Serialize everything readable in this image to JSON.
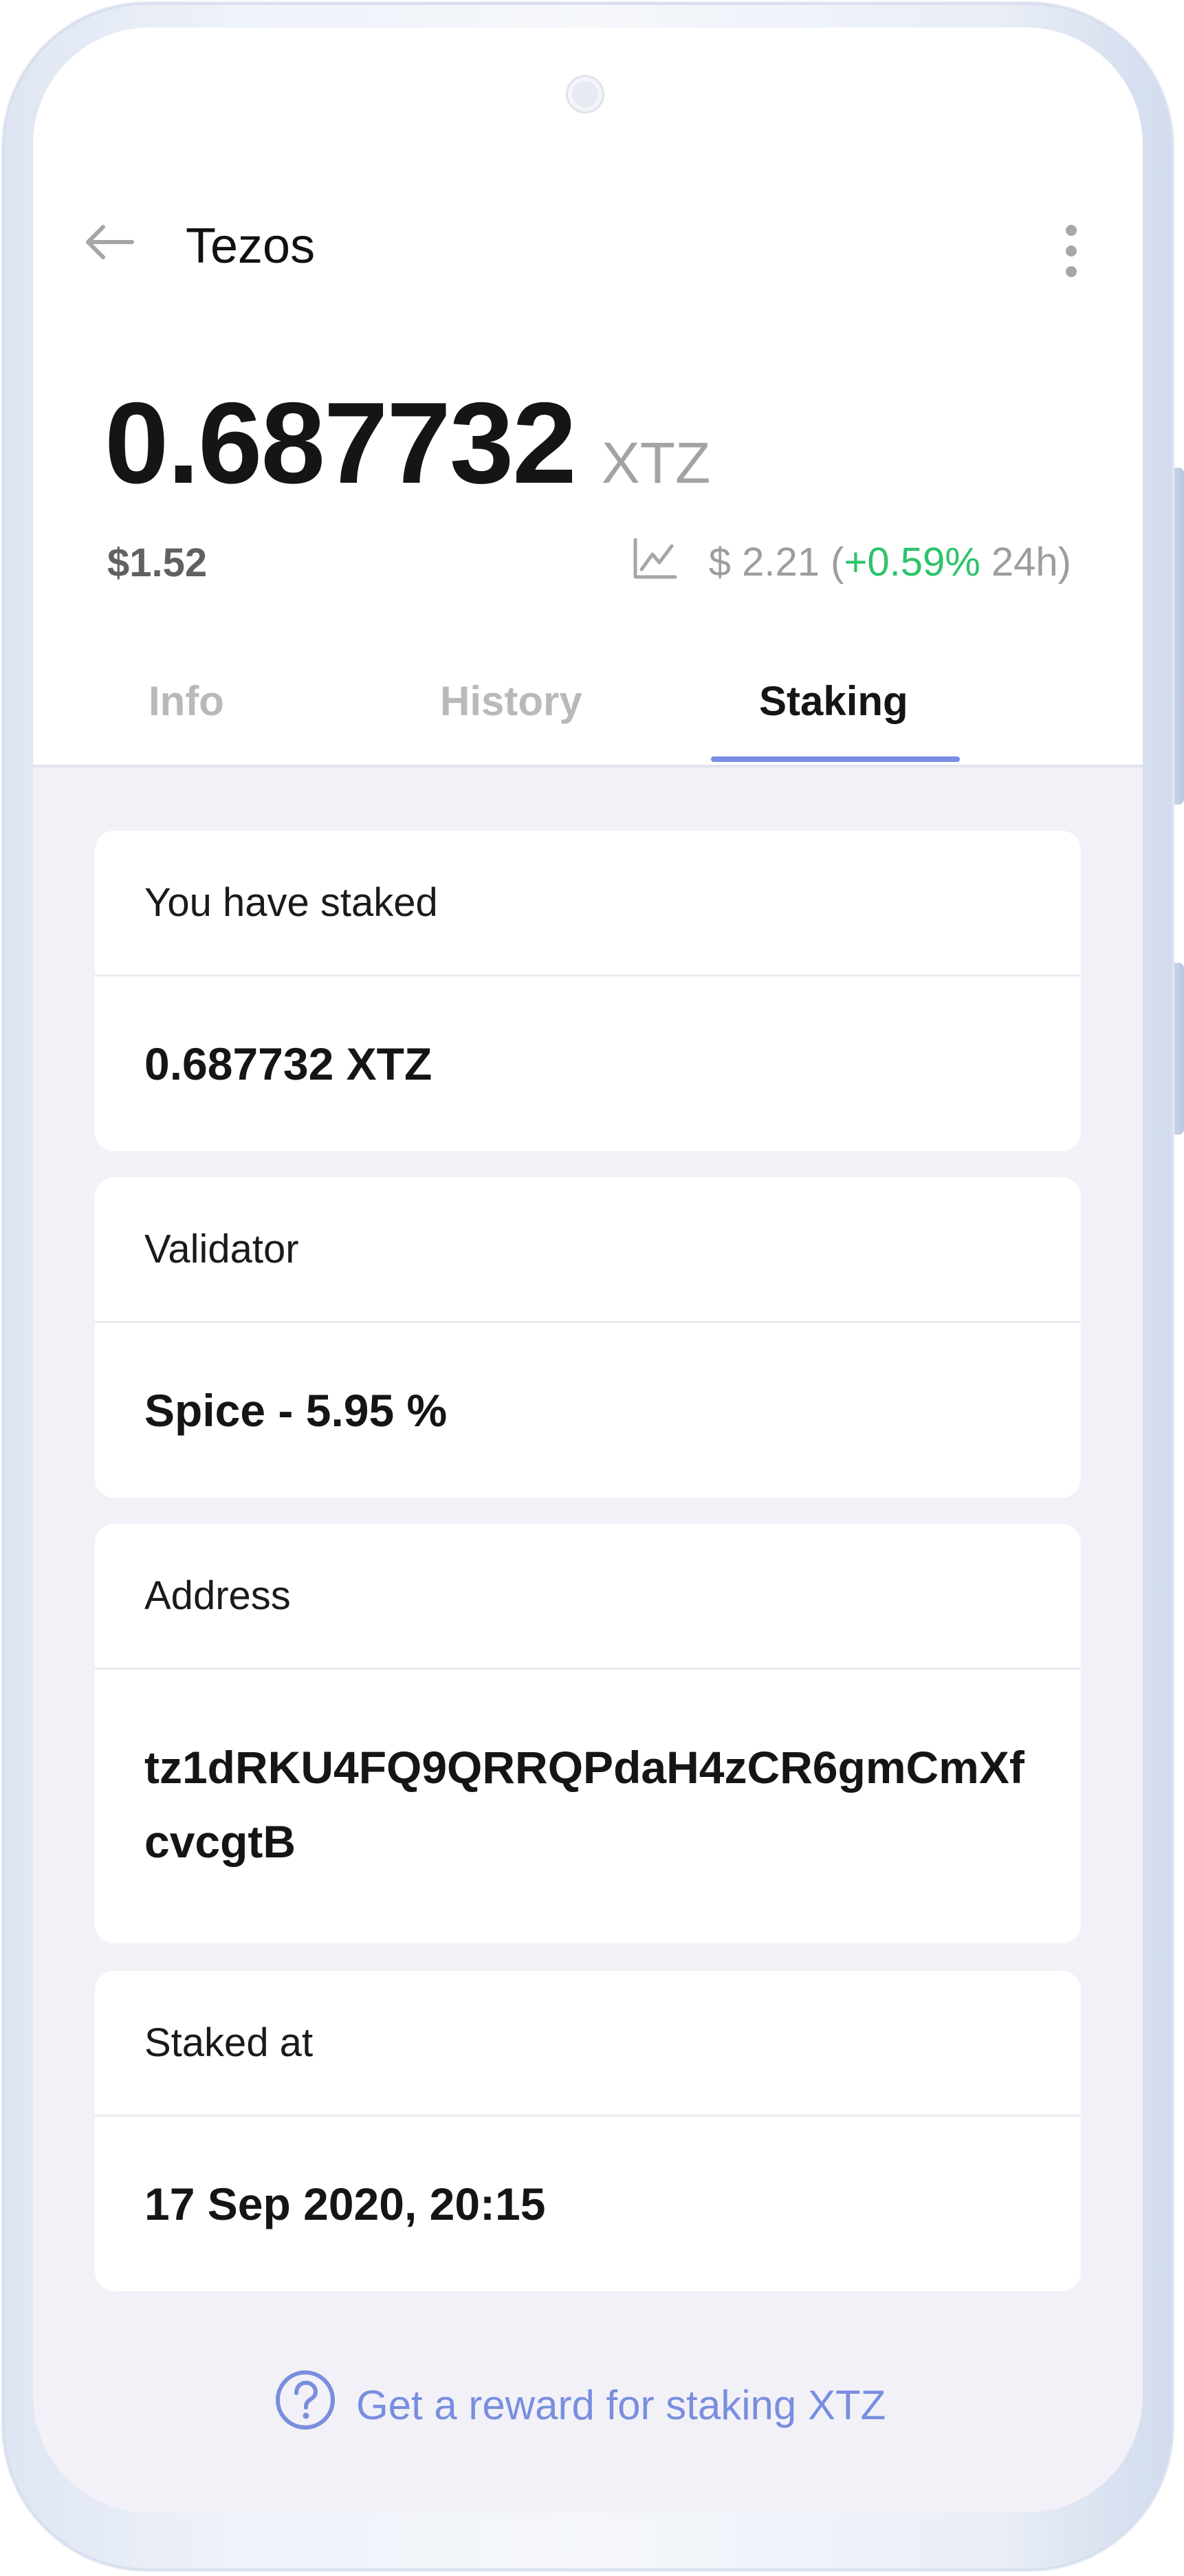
{
  "header": {
    "title": "Tezos"
  },
  "balance": {
    "amount": "0.687732",
    "ticker": "XTZ",
    "fiat_value": "$1.52"
  },
  "price": {
    "label": "$ 2.21 (",
    "change": "+0.59%",
    "period": " 24h)"
  },
  "tabs": [
    {
      "label": "Info",
      "active": false
    },
    {
      "label": "History",
      "active": false
    },
    {
      "label": "Staking",
      "active": true
    }
  ],
  "staking": {
    "staked_label": "You have staked",
    "staked_value": "0.687732 XTZ",
    "validator_label": "Validator",
    "validator_value": "Spice - 5.95 %",
    "address_label": "Address",
    "address_value": "tz1dRKU4FQ9QRRQPdaH4zCR6gmCmXfcvcgtB",
    "staked_at_label": "Staked at",
    "staked_at_value": "17 Sep 2020, 20:15"
  },
  "footer": {
    "reward_link": "Get a reward for staking XTZ"
  },
  "colors": {
    "accent": "#7b8ce5",
    "positive": "#2cc36b",
    "background": "#f1f1f7"
  },
  "icons": [
    "arrow-left-icon",
    "more-vertical-icon",
    "chart-line-icon",
    "question-circle-icon"
  ]
}
